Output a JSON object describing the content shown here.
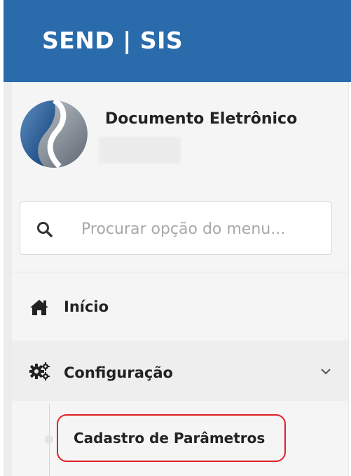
{
  "header": {
    "brand": "SEND | SIS"
  },
  "user_panel": {
    "name": "Documento Eletrônico"
  },
  "search": {
    "placeholder": "Procurar opção do menu..."
  },
  "menu": {
    "home": {
      "label": "Início",
      "icon": "home-icon"
    },
    "config": {
      "label": "Configuração",
      "icon": "gears-icon",
      "expanded": true,
      "children": [
        {
          "label": "Cadastro de Parâmetros",
          "highlighted": true
        }
      ]
    }
  },
  "colors": {
    "header_bg": "#2a6bab",
    "sidebar_bg": "#f5f5f5",
    "highlight_border": "#e21f26"
  }
}
